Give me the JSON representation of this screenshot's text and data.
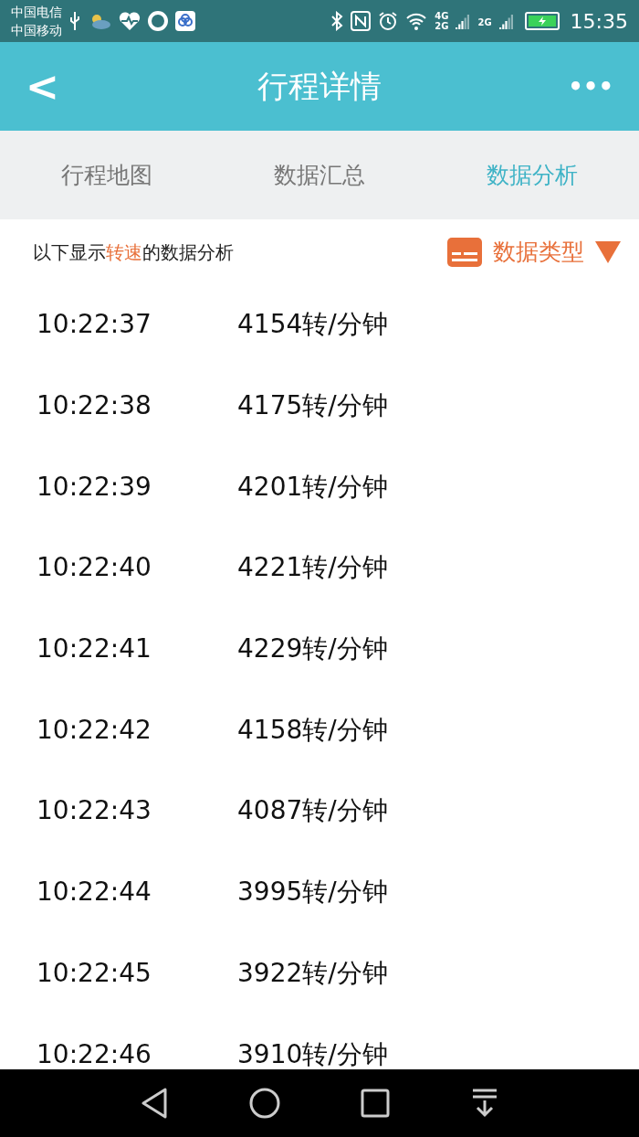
{
  "status_bar": {
    "carriers": [
      "中国电信",
      "中国移动"
    ],
    "network_labels": [
      "4G",
      "2G",
      "2G"
    ],
    "time": "15:35",
    "battery_charging": true
  },
  "header": {
    "back": "<",
    "title": "行程详情",
    "more": "•••"
  },
  "tabs": [
    {
      "label": "行程地图",
      "selected": false
    },
    {
      "label": "数据汇总",
      "selected": false
    },
    {
      "label": "数据分析",
      "selected": true
    }
  ],
  "subheader": {
    "caption": "以下显示**转速**的数据分析",
    "data_type_button": "数据类型"
  },
  "rows": [
    {
      "time": "10:22:37",
      "value": "4154转/分钟"
    },
    {
      "time": "10:22:38",
      "value": "4175转/分钟"
    },
    {
      "time": "10:22:39",
      "value": "4201转/分钟"
    },
    {
      "time": "10:22:40",
      "value": "4221转/分钟"
    },
    {
      "time": "10:22:41",
      "value": "4229转/分钟"
    },
    {
      "time": "10:22:42",
      "value": "4158转/分钟"
    },
    {
      "time": "10:22:43",
      "value": "4087转/分钟"
    },
    {
      "time": "10:22:44",
      "value": "3995转/分钟"
    },
    {
      "time": "10:22:45",
      "value": "3922转/分钟"
    },
    {
      "time": "10:22:46",
      "value": "3910转/分钟"
    }
  ]
}
